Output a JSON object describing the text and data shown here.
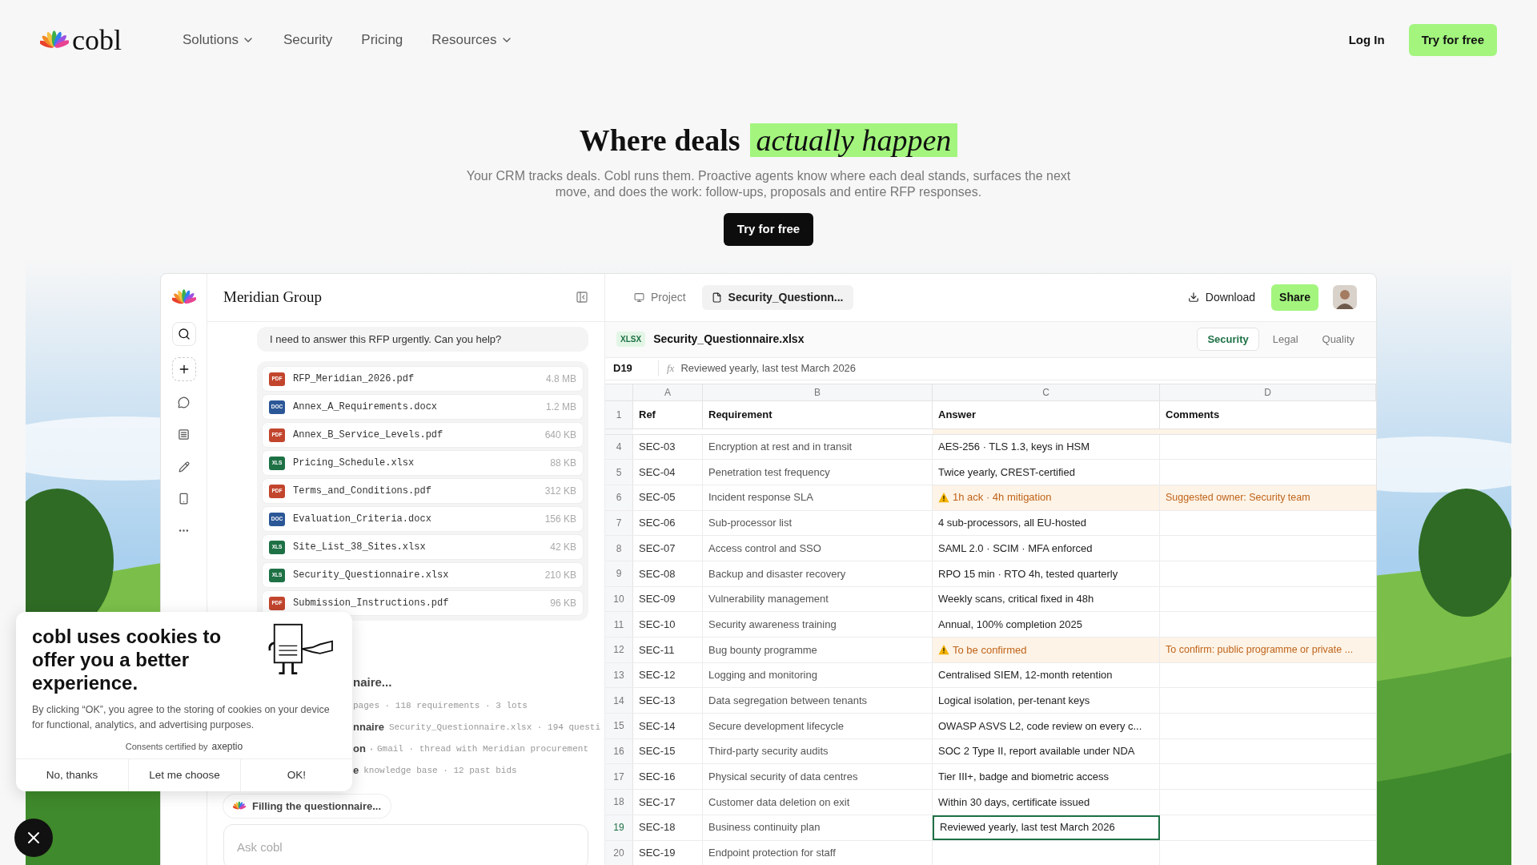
{
  "nav": {
    "brand": "cobl",
    "links": [
      {
        "label": "Solutions",
        "has_menu": true
      },
      {
        "label": "Security",
        "has_menu": false
      },
      {
        "label": "Pricing",
        "has_menu": false
      },
      {
        "label": "Resources",
        "has_menu": true
      }
    ],
    "login": "Log In",
    "cta": "Try for free"
  },
  "hero": {
    "title": "Where deals",
    "highlight": "actually happen",
    "subtitle": "Your CRM tracks deals. Cobl runs them. Proactive agents know where each deal stands, surfaces the next move, and does the work: follow-ups, proposals and entire RFP responses.",
    "cta": "Try for free"
  },
  "app": {
    "workspace": "Meridian Group",
    "chat": {
      "message": "I need to answer this RFP urgently. Can you help?",
      "files": [
        {
          "kind": "pdf",
          "badge": "PDF",
          "name": "RFP_Meridian_2026.pdf",
          "size": "4.8 MB"
        },
        {
          "kind": "doc",
          "badge": "DOC",
          "name": "Annex_A_Requirements.docx",
          "size": "1.2 MB"
        },
        {
          "kind": "pdf",
          "badge": "PDF",
          "name": "Annex_B_Service_Levels.pdf",
          "size": "640 KB"
        },
        {
          "kind": "xls",
          "badge": "XLS",
          "name": "Pricing_Schedule.xlsx",
          "size": "88 KB"
        },
        {
          "kind": "pdf",
          "badge": "PDF",
          "name": "Terms_and_Conditions.pdf",
          "size": "312 KB"
        },
        {
          "kind": "doc",
          "badge": "DOC",
          "name": "Evaluation_Criteria.docx",
          "size": "156 KB"
        },
        {
          "kind": "xls",
          "badge": "XLS",
          "name": "Site_List_38_Sites.xlsx",
          "size": "42 KB"
        },
        {
          "kind": "xls",
          "badge": "XLS",
          "name": "Security_Questionnaire.xlsx",
          "size": "210 KB"
        },
        {
          "kind": "pdf",
          "badge": "PDF",
          "name": "Submission_Instructions.pdf",
          "size": "96 KB"
        }
      ],
      "step_title": "naire...",
      "sources": [
        {
          "kind": "text",
          "detail": "pages · 118 requirements · 3 lots"
        },
        {
          "kind": "text",
          "label": "nnaire",
          "detail": "Security_Questionnaire.xlsx · 194 questi"
        },
        {
          "kind": "mail",
          "label": "on",
          "detail": "Gmail · thread with Meridian procurement"
        },
        {
          "kind": "text",
          "label": "e",
          "detail": "knowledge base · 12 past bids"
        }
      ],
      "status": "Filling the questionnaire...",
      "input_placeholder": "Ask cobl"
    },
    "sheet": {
      "tabs": [
        {
          "label": "Project",
          "selected": false
        },
        {
          "label": "Security_Questionn...",
          "selected": true
        }
      ],
      "download": "Download",
      "share": "Share",
      "file_badge": "XLSX",
      "file_name": "Security_Questionnaire.xlsx",
      "sheets": [
        {
          "label": "Security",
          "selected": true
        },
        {
          "label": "Legal",
          "selected": false
        },
        {
          "label": "Quality",
          "selected": false
        }
      ],
      "cell_ref": "D19",
      "fx": "fx",
      "formula": "Reviewed yearly, last test March 2026",
      "columns": [
        "A",
        "B",
        "C",
        "D"
      ],
      "header": {
        "row_number": "1",
        "ref": "Ref",
        "requirement": "Requirement",
        "answer": "Answer",
        "comments": "Comments"
      },
      "rows": [
        {
          "row_number": "4",
          "ref": "SEC-03",
          "requirement": "Encryption at rest and in transit",
          "answer": "AES-256 · TLS 1.3, keys in HSM",
          "flagged": false,
          "selected": false
        },
        {
          "row_number": "5",
          "ref": "SEC-04",
          "requirement": "Penetration test frequency",
          "answer": "Twice yearly, CREST-certified",
          "flagged": false,
          "selected": false
        },
        {
          "row_number": "6",
          "ref": "SEC-05",
          "requirement": "Incident response SLA",
          "answer": "1h ack · 4h mitigation",
          "comments": "Suggested owner: Security team",
          "flagged": true,
          "selected": false
        },
        {
          "row_number": "7",
          "ref": "SEC-06",
          "requirement": "Sub-processor list",
          "answer": "4 sub-processors, all EU-hosted",
          "flagged": false,
          "selected": false
        },
        {
          "row_number": "8",
          "ref": "SEC-07",
          "requirement": "Access control and SSO",
          "answer": "SAML 2.0 · SCIM · MFA enforced",
          "flagged": false,
          "selected": false
        },
        {
          "row_number": "9",
          "ref": "SEC-08",
          "requirement": "Backup and disaster recovery",
          "answer": "RPO 15 min · RTO 4h, tested quarterly",
          "flagged": false,
          "selected": false
        },
        {
          "row_number": "10",
          "ref": "SEC-09",
          "requirement": "Vulnerability management",
          "answer": "Weekly scans, critical fixed in 48h",
          "flagged": false,
          "selected": false
        },
        {
          "row_number": "11",
          "ref": "SEC-10",
          "requirement": "Security awareness training",
          "answer": "Annual, 100% completion 2025",
          "flagged": false,
          "selected": false
        },
        {
          "row_number": "12",
          "ref": "SEC-11",
          "requirement": "Bug bounty programme",
          "answer": "To be confirmed",
          "comments": "To confirm: public programme or private ...",
          "flagged": true,
          "selected": false
        },
        {
          "row_number": "13",
          "ref": "SEC-12",
          "requirement": "Logging and monitoring",
          "answer": "Centralised SIEM, 12-month retention",
          "flagged": false,
          "selected": false
        },
        {
          "row_number": "14",
          "ref": "SEC-13",
          "requirement": "Data segregation between tenants",
          "answer": "Logical isolation, per-tenant keys",
          "flagged": false,
          "selected": false
        },
        {
          "row_number": "15",
          "ref": "SEC-14",
          "requirement": "Secure development lifecycle",
          "answer": "OWASP ASVS L2, code review on every c...",
          "flagged": false,
          "selected": false
        },
        {
          "row_number": "16",
          "ref": "SEC-15",
          "requirement": "Third-party security audits",
          "answer": "SOC 2 Type II, report available under NDA",
          "flagged": false,
          "selected": false
        },
        {
          "row_number": "17",
          "ref": "SEC-16",
          "requirement": "Physical security of data centres",
          "answer": "Tier III+, badge and biometric access",
          "flagged": false,
          "selected": false
        },
        {
          "row_number": "18",
          "ref": "SEC-17",
          "requirement": "Customer data deletion on exit",
          "answer": "Within 30 days, certificate issued",
          "flagged": false,
          "selected": false
        },
        {
          "row_number": "19",
          "ref": "SEC-18",
          "requirement": "Business continuity plan",
          "answer": "Reviewed yearly, last test March 2026",
          "flagged": false,
          "selected": true
        },
        {
          "row_number": "20",
          "ref": "SEC-19",
          "requirement": "Endpoint protection for staff",
          "flagged": false,
          "selected": false
        }
      ]
    }
  },
  "cookie": {
    "title": "cobl uses cookies to offer you a better experience.",
    "body": "By clicking “OK”, you agree to the storing of cookies on your device for functional, analytics, and advertising purposes.",
    "certified": "Consents certified by",
    "certifier": "axeptio",
    "buttons": [
      "No, thanks",
      "Let me choose",
      "OK!"
    ]
  }
}
